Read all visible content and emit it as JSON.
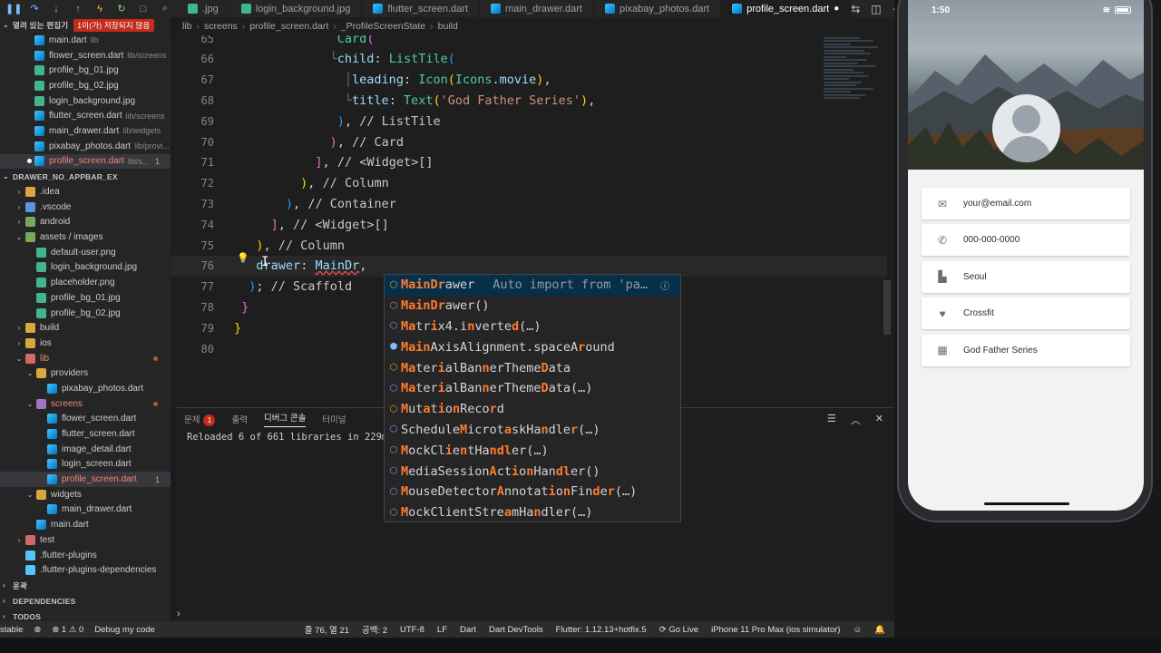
{
  "debug_toolbar": {
    "icons": [
      "pause-icon",
      "step-over-icon",
      "step-into-icon",
      "step-out-icon",
      "hot-reload-icon",
      "restart-icon",
      "stop-icon",
      "search-icon"
    ]
  },
  "tabs": [
    {
      "label": ".jpg",
      "icon": "image",
      "active": false
    },
    {
      "label": "login_background.jpg",
      "icon": "image",
      "active": false
    },
    {
      "label": "flutter_screen.dart",
      "icon": "dart",
      "active": false
    },
    {
      "label": "main_drawer.dart",
      "icon": "dart",
      "active": false
    },
    {
      "label": "pixabay_photos.dart",
      "icon": "dart",
      "active": false
    },
    {
      "label": "profile_screen.dart",
      "icon": "dart",
      "active": true,
      "modified_marker": "●"
    }
  ],
  "breadcrumb": [
    "lib",
    "screens",
    "profile_screen.dart",
    "_ProfileScreenState",
    "build"
  ],
  "sidebar": {
    "open_editors": {
      "title": "열려 있는 편집기",
      "badge": "1이(가) 저장되지 않음",
      "items": [
        {
          "name": "main.dart",
          "desc": "lib",
          "icon": "dart"
        },
        {
          "name": "flower_screen.dart",
          "desc": "lib/screens",
          "icon": "dart"
        },
        {
          "name": "profile_bg_01.jpg",
          "desc": "",
          "icon": "img"
        },
        {
          "name": "profile_bg_02.jpg",
          "desc": "",
          "icon": "img"
        },
        {
          "name": "login_background.jpg",
          "desc": "",
          "icon": "img"
        },
        {
          "name": "flutter_screen.dart",
          "desc": "lib/screens",
          "icon": "dart"
        },
        {
          "name": "main_drawer.dart",
          "desc": "lib/widgets",
          "icon": "dart"
        },
        {
          "name": "pixabay_photos.dart",
          "desc": "lib/provi...",
          "icon": "dart"
        },
        {
          "name": "profile_screen.dart",
          "desc": "lib/s...",
          "icon": "dart",
          "error": "1",
          "modified": true
        }
      ]
    },
    "project": {
      "title": "DRAWER_NO_APPBAR_EX",
      "items": [
        {
          "name": ".idea",
          "indent": 1,
          "chev": "›",
          "icon": "folder"
        },
        {
          "name": ".vscode",
          "indent": 1,
          "chev": "›",
          "icon": "folder-blue"
        },
        {
          "name": "android",
          "indent": 1,
          "chev": "›",
          "icon": "folder-green"
        },
        {
          "name": "assets / images",
          "indent": 1,
          "chev": "⌄",
          "icon": "folder-green"
        },
        {
          "name": "default-user.png",
          "indent": 2,
          "chev": "",
          "icon": "img"
        },
        {
          "name": "login_background.jpg",
          "indent": 2,
          "chev": "",
          "icon": "img"
        },
        {
          "name": "placeholder.png",
          "indent": 2,
          "chev": "",
          "icon": "img"
        },
        {
          "name": "profile_bg_01.jpg",
          "indent": 2,
          "chev": "",
          "icon": "img"
        },
        {
          "name": "profile_bg_02.jpg",
          "indent": 2,
          "chev": "",
          "icon": "img"
        },
        {
          "name": "build",
          "indent": 1,
          "chev": "›",
          "icon": "folder"
        },
        {
          "name": "ios",
          "indent": 1,
          "chev": "›",
          "icon": "folder"
        },
        {
          "name": "lib",
          "indent": 1,
          "chev": "⌄",
          "icon": "folder-red",
          "error_dot": true
        },
        {
          "name": "providers",
          "indent": 2,
          "chev": "⌄",
          "icon": "folder"
        },
        {
          "name": "pixabay_photos.dart",
          "indent": 3,
          "chev": "",
          "icon": "dart"
        },
        {
          "name": "screens",
          "indent": 2,
          "chev": "⌄",
          "icon": "folder-purple",
          "error_dot": true
        },
        {
          "name": "flower_screen.dart",
          "indent": 3,
          "chev": "",
          "icon": "dart"
        },
        {
          "name": "flutter_screen.dart",
          "indent": 3,
          "chev": "",
          "icon": "dart"
        },
        {
          "name": "image_detail.dart",
          "indent": 3,
          "chev": "",
          "icon": "dart"
        },
        {
          "name": "login_screen.dart",
          "indent": 3,
          "chev": "",
          "icon": "dart"
        },
        {
          "name": "profile_screen.dart",
          "indent": 3,
          "chev": "",
          "icon": "dart",
          "error": "1",
          "selected": true
        },
        {
          "name": "widgets",
          "indent": 2,
          "chev": "⌄",
          "icon": "folder"
        },
        {
          "name": "main_drawer.dart",
          "indent": 3,
          "chev": "",
          "icon": "dart"
        },
        {
          "name": "main.dart",
          "indent": 2,
          "chev": "",
          "icon": "dart"
        },
        {
          "name": "test",
          "indent": 1,
          "chev": "›",
          "icon": "folder-red"
        },
        {
          "name": ".flutter-plugins",
          "indent": 1,
          "chev": "",
          "icon": "flutter"
        },
        {
          "name": ".flutter-plugins-dependencies",
          "indent": 1,
          "chev": "",
          "icon": "flutter"
        }
      ]
    },
    "bottom_sections": [
      "윤곽",
      "DEPENDENCIES",
      "TODOS"
    ]
  },
  "editor": {
    "lines": [
      {
        "n": "65",
        "html": "<span class='guide'>              </span><span class='ty'>Card</span><span class='br2'>(</span>"
      },
      {
        "n": "66",
        "html": "<span class='guide'>             └</span><span class='id'>child</span><span class='pu'>: </span><span class='ty'>ListTile</span><span class='br3'>(</span>"
      },
      {
        "n": "67",
        "html": "<span class='guide'>               │</span><span class='id'>leading</span><span class='pu'>: </span><span class='ty'>Icon</span><span class='br1'>(</span><span class='ty'>Icons</span><span class='pu'>.</span><span class='id'>movie</span><span class='br1'>)</span><span class='pu'>,</span>"
      },
      {
        "n": "68",
        "html": "<span class='guide'>               └</span><span class='id'>title</span><span class='pu'>: </span><span class='ty'>Text</span><span class='br1'>(</span><span class='str'>'God Father Series'</span><span class='br1'>)</span><span class='pu'>,</span>"
      },
      {
        "n": "69",
        "html": "<span class='guide'>              </span><span class='br3'>)</span><span class='pu'>, </span><span class='cm'>// ListTile</span>"
      },
      {
        "n": "70",
        "html": "<span class='guide'>             </span><span class='br2'>)</span><span class='pu'>, </span><span class='cm'>// Card</span>"
      },
      {
        "n": "71",
        "html": "<span class='guide'>           </span><span class='br2'>]</span><span class='pu'>, </span><span class='cm'>// &lt;Widget&gt;[]</span>"
      },
      {
        "n": "72",
        "html": "<span class='guide'>         </span><span class='br1'>)</span><span class='pu'>, </span><span class='cm'>// Column</span>"
      },
      {
        "n": "73",
        "html": "<span class='guide'>       </span><span class='br3'>)</span><span class='pu'>, </span><span class='cm'>// Container</span>"
      },
      {
        "n": "74",
        "html": "<span class='guide'>     </span><span class='br2'>]</span><span class='pu'>, </span><span class='cm'>// &lt;Widget&gt;[]</span>"
      },
      {
        "n": "75",
        "html": "<span class='guide'>   </span><span class='br1'>)</span><span class='pu'>, </span><span class='cm'>// Column</span>"
      },
      {
        "n": "76",
        "html": "<span class='guide'>  </span><span class='pu'> </span><span class='id'>drawer</span><span class='pu'>: </span><span class='id squig'>MainDr</span><span class='pu'>,</span>",
        "current": true
      },
      {
        "n": "77",
        "html": "<span class='guide'>  </span><span class='br3'>)</span><span class='pu'>; </span><span class='cm'>// Scaffold</span>"
      },
      {
        "n": "78",
        "html": "<span class='guide'> </span><span class='br2'>}</span>"
      },
      {
        "n": "79",
        "html": "<span class='br1'>}</span>"
      },
      {
        "n": "80",
        "html": ""
      }
    ]
  },
  "suggestions": [
    {
      "kind": "cls",
      "html": "<b>MainDr</b>awer",
      "detail": "Auto import from 'pa…",
      "first": true
    },
    {
      "kind": "method",
      "html": "<b>MainDr</b>awer()"
    },
    {
      "kind": "method",
      "html": "<b>Ma</b>tr<b>i</b>x4.i<b>n</b>verte<b>d</b>(…)"
    },
    {
      "kind": "field",
      "html": "<b>Main</b>AxisAlignment.spaceA<b>r</b>ound"
    },
    {
      "kind": "cls",
      "html": "<b>Ma</b>ter<b>i</b>alBan<b>n</b>erTheme<b>D</b>ata"
    },
    {
      "kind": "method",
      "html": "<b>Ma</b>ter<b>i</b>alBan<b>n</b>erTheme<b>D</b>ata(…)"
    },
    {
      "kind": "cls",
      "html": "<b>M</b>ut<b>a</b>t<b>i</b>o<b>n</b>Reco<b>r</b>d"
    },
    {
      "kind": "method",
      "html": "Schedule<b>M</b>icrot<b>a</b>skHa<b>n</b>dle<b>r</b>(…)"
    },
    {
      "kind": "method",
      "html": "<b>M</b>ockCl<b>i</b>e<b>n</b>tHa<b>ndl</b>er(…)"
    },
    {
      "kind": "method",
      "html": "<b>M</b>ediaSession<b>A</b>ct<b>i</b>o<b>n</b>Han<b>dl</b>er()"
    },
    {
      "kind": "method",
      "html": "<b>M</b>ouseDetector<b>A</b>nnotat<b>i</b>o<b>n</b>Fin<b>d</b>e<b>r</b>(…)"
    },
    {
      "kind": "method",
      "html": "<b>M</b>ockClientStre<b>a</b>mHa<b>n</b>dler(…)"
    }
  ],
  "panel": {
    "tabs": [
      {
        "label": "문제",
        "badge": "1"
      },
      {
        "label": "출력"
      },
      {
        "label": "디버그 콘솔",
        "active": true
      },
      {
        "label": "터미널"
      }
    ],
    "output": "Reloaded 6 of 661 libraries in 229ms.",
    "prompt": "›"
  },
  "status_bar": {
    "left": [
      "stable",
      "⊗",
      "⊗ 1 ⚠ 0",
      "Debug my code"
    ],
    "right": [
      "줄 76, 열 21",
      "공백: 2",
      "UTF-8",
      "LF",
      "Dart",
      "Dart DevTools",
      "Flutter: 1.12.13+hotfix.5",
      "⟳ Go Live",
      "iPhone 11 Pro Max (ios simulator)",
      "☺",
      "🔔"
    ]
  },
  "simulator": {
    "time": "1:50",
    "items": [
      {
        "icon": "email-icon",
        "glyph": "✉",
        "text": "your@email.com"
      },
      {
        "icon": "phone-icon",
        "glyph": "✆",
        "text": "000-000-0000"
      },
      {
        "icon": "location-city-icon",
        "glyph": "▙",
        "text": "Seoul"
      },
      {
        "icon": "favorite-icon",
        "glyph": "♥",
        "text": "Crossfit"
      },
      {
        "icon": "movie-icon",
        "glyph": "▦",
        "text": "God Father Series"
      }
    ]
  }
}
